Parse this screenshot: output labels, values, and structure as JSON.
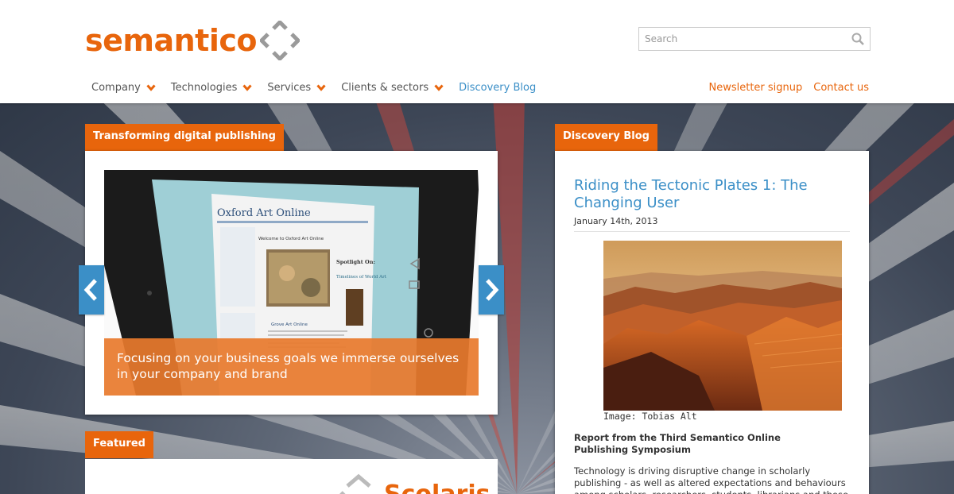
{
  "header": {
    "logo_text": "semantico",
    "search": {
      "placeholder": "Search"
    },
    "nav": [
      {
        "label": "Company",
        "has_dropdown": true
      },
      {
        "label": "Technologies",
        "has_dropdown": true
      },
      {
        "label": "Services",
        "has_dropdown": true
      },
      {
        "label": "Clients & sectors",
        "has_dropdown": true
      },
      {
        "label": "Discovery Blog",
        "has_dropdown": false
      }
    ],
    "nav_right": [
      {
        "label": "Newsletter signup"
      },
      {
        "label": "Contact us"
      }
    ]
  },
  "slider": {
    "tab_label": "Transforming digital publishing",
    "caption": "Focusing on your business goals we immerse ourselves in your company and brand",
    "prev_icon": "chevron-left-icon",
    "next_icon": "chevron-right-icon",
    "screen_site": {
      "title": "Oxford Art Online",
      "welcome": "Welcome to Oxford Art Online",
      "spotlight": "Spotlight On:",
      "feature": "Timelines of World Art",
      "grove": "Grove Art Online"
    }
  },
  "featured": {
    "tab_label": "Featured",
    "partial_logo_text": "Scolaris"
  },
  "blog": {
    "tab_label": "Discovery Blog",
    "post_title": "Riding the Tectonic Plates 1: The Changing User",
    "post_date": "January 14th, 2013",
    "image_credit": "Image: Tobias Alt",
    "report_heading": "Report from the Third Semantico Online Publishing Symposium",
    "body": "Technology is driving disruptive change in scholarly publishing - as well as altered expectations and behaviours among scholars, researchers, students, librarians and those who set"
  },
  "colors": {
    "brand_orange": "#e8650c",
    "link_blue": "#3b8fc7",
    "logo_grey": "#9a9a9a"
  }
}
